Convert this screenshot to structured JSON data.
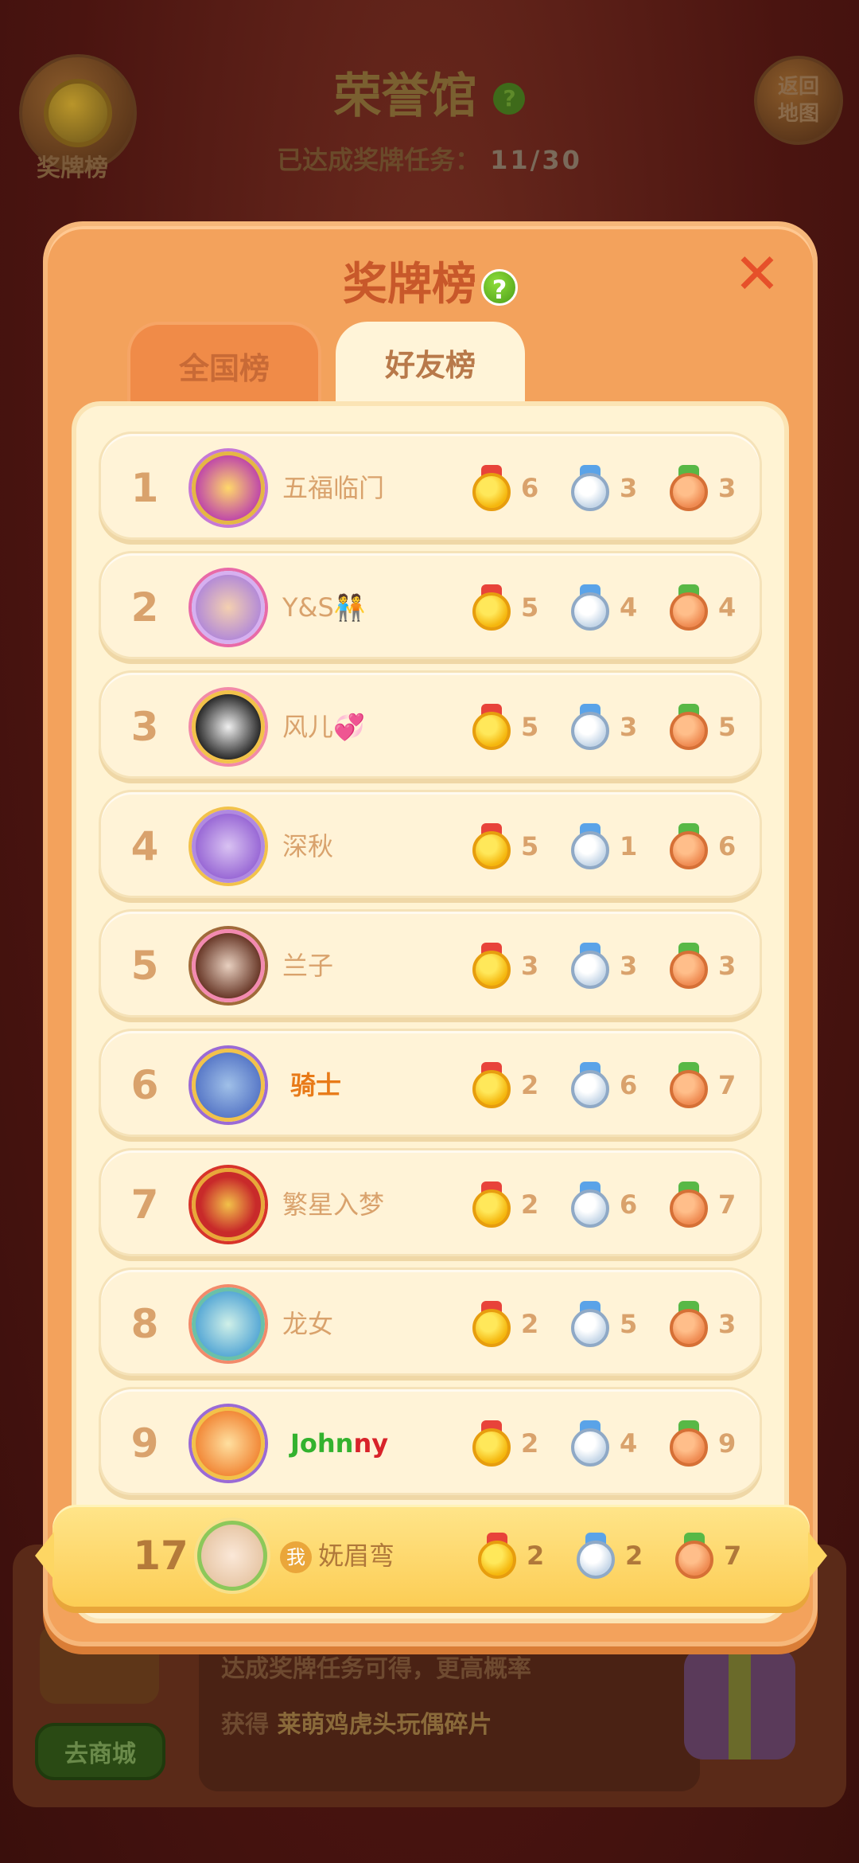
{
  "background": {
    "left_button_label": "奖牌榜",
    "right_button_label": "返回地图",
    "title": "荣誉馆",
    "title_help": "?",
    "progress_label": "已达成奖牌任务：",
    "progress_value": "11/30",
    "shop_button": "去商城",
    "info_line1": "达成奖牌任务可得",
    "info_line1_suffix": "，更高概率",
    "info_line2_prefix": "获得",
    "info_line2_highlight": "莱萌鸡虎头玩偶碎片"
  },
  "modal": {
    "title": "奖牌榜",
    "help": "?",
    "close": "✕",
    "tabs": [
      {
        "label": "全国榜",
        "active": false
      },
      {
        "label": "好友榜",
        "active": true
      }
    ]
  },
  "rows": [
    {
      "rank": "1",
      "name": "五福临门",
      "gold": "6",
      "silver": "3",
      "bronze": "3",
      "avatar_color": "#c04aa8"
    },
    {
      "rank": "2",
      "name": "Y&S🧑‍🤝‍🧑",
      "gold": "5",
      "silver": "4",
      "bronze": "4",
      "avatar_color": "#b58cd6"
    },
    {
      "rank": "3",
      "name": "风儿💞",
      "gold": "5",
      "silver": "3",
      "bronze": "5",
      "avatar_color": "#2b2b2b"
    },
    {
      "rank": "4",
      "name": "深秋",
      "gold": "5",
      "silver": "1",
      "bronze": "6",
      "avatar_color": "#9a6ad6"
    },
    {
      "rank": "5",
      "name": "兰子",
      "gold": "3",
      "silver": "3",
      "bronze": "3",
      "avatar_color": "#6a3a2a"
    },
    {
      "rank": "6",
      "name": "骑士",
      "gold": "2",
      "silver": "6",
      "bronze": "7",
      "avatar_color": "#5a7ac8"
    },
    {
      "rank": "7",
      "name": "繁星入梦",
      "gold": "2",
      "silver": "6",
      "bronze": "7",
      "avatar_color": "#c82a2a"
    },
    {
      "rank": "8",
      "name": "龙女",
      "gold": "2",
      "silver": "5",
      "bronze": "3",
      "avatar_color": "#5aaad6"
    },
    {
      "rank": "9",
      "name_part1": "John",
      "name_part2": "ny",
      "gold": "2",
      "silver": "4",
      "bronze": "9",
      "avatar_color": "#f28a3a"
    }
  ],
  "me": {
    "rank": "17",
    "badge": "我",
    "name": "妩眉弯",
    "gold": "2",
    "silver": "2",
    "bronze": "7",
    "avatar_color": "#e8c8a8"
  }
}
